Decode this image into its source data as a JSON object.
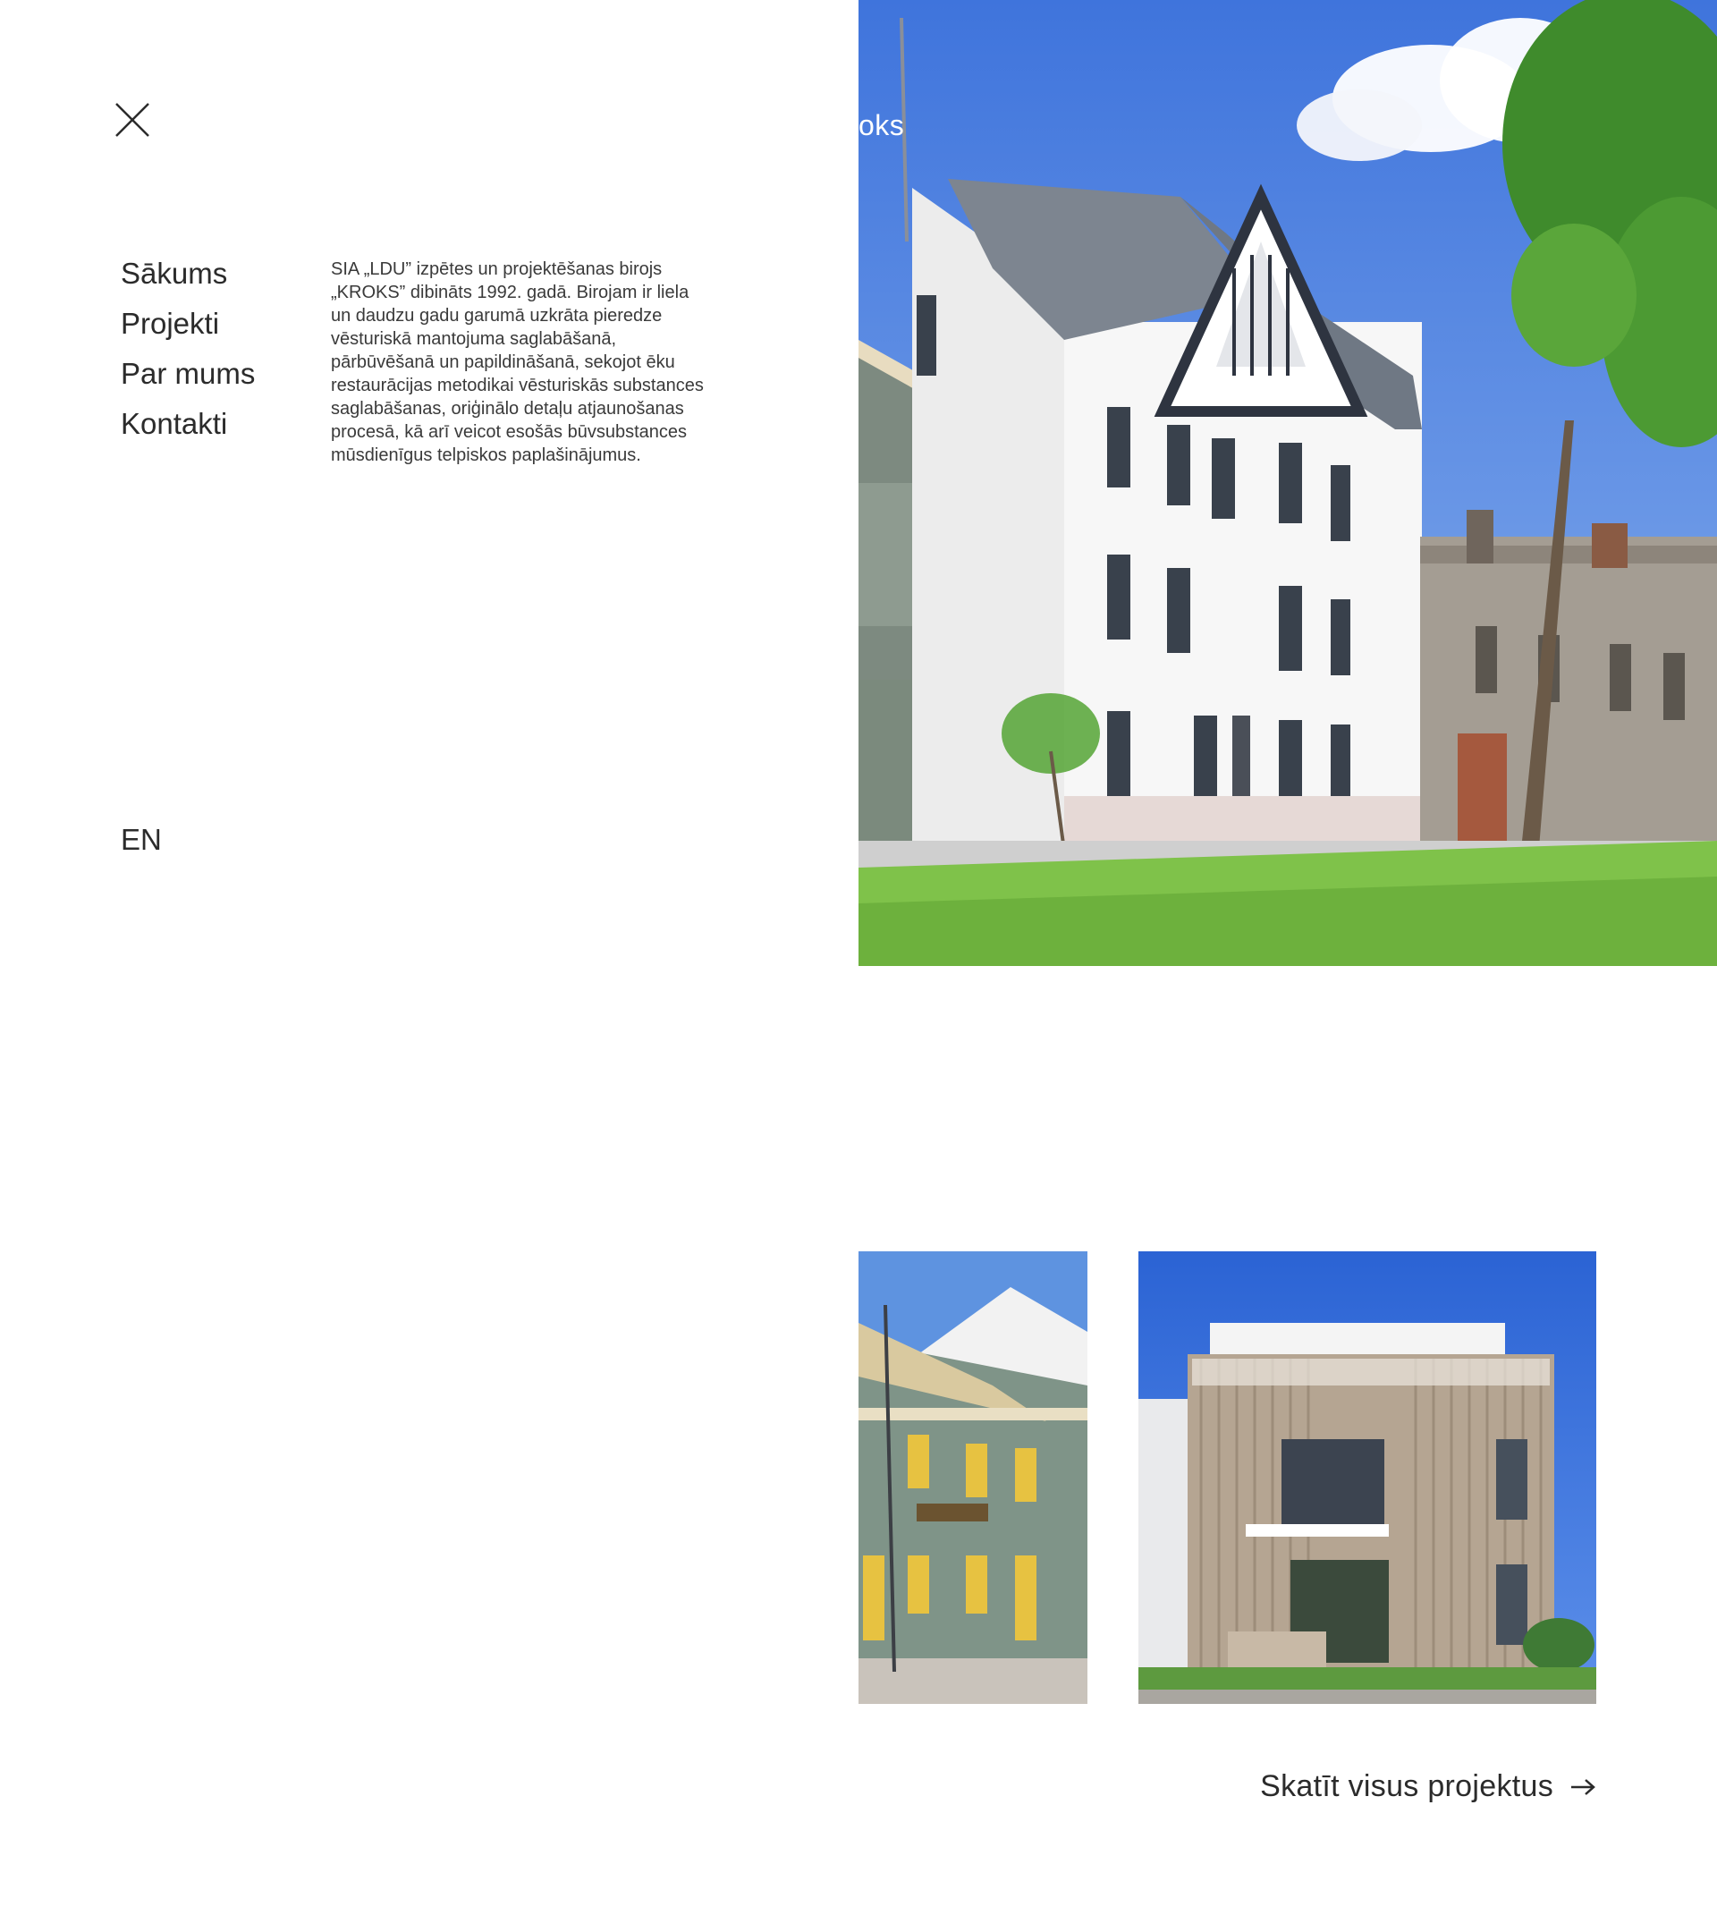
{
  "logo_fragment": "oks",
  "menu": {
    "close_label": "close-icon",
    "items": [
      {
        "label": "Sākums"
      },
      {
        "label": "Projekti"
      },
      {
        "label": "Par mums"
      },
      {
        "label": "Kontakti"
      }
    ],
    "language": "EN"
  },
  "about": {
    "text": "SIA „LDU” izpētes un projektēšanas birojs „KROKS” dibināts 1992. gadā. Birojam ir liela un daudzu gadu garumā uzkrāta pieredze vēsturiskā mantojuma saglabāšanā, pārbūvēšanā un papildināšanā, sekojot ēku restaurācijas metodikai vēsturiskās substances saglabāšanas, oriģinālo detaļu atjaunošanas procesā, kā arī veicot esošās būvsubstances mūsdienīgus telpiskos paplašinājumus."
  },
  "projects": {
    "view_all_label": "Skatīt visus projektus",
    "arrow_icon": "arrow-right-icon"
  },
  "colors": {
    "sky": "#4a7fe0",
    "grass": "#7fc24a",
    "text": "#2b2b2b"
  }
}
